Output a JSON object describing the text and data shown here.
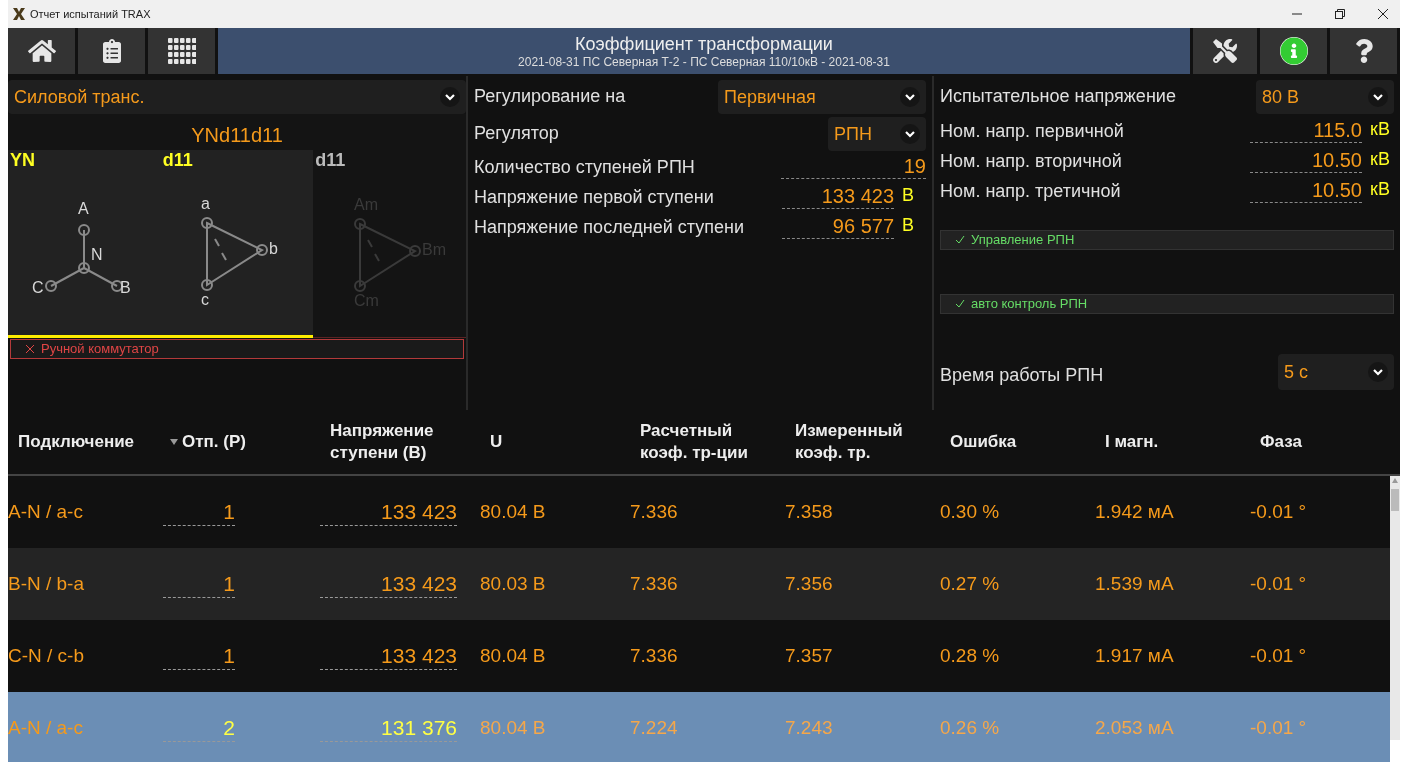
{
  "window": {
    "title": "Отчет испытаний TRAX"
  },
  "toolbar": {
    "title": "Коэффициент трансформации",
    "subtitle": "2021-08-31 ПС Северная Т-2 - ПС Северная 110/10кВ - 2021-08-31"
  },
  "left_panel": {
    "device": "Силовой транс.",
    "vector_group": "YNd11d11",
    "windings": [
      {
        "label": "YN",
        "kind": "star",
        "active": true,
        "terminals": [
          "A",
          "N",
          "C",
          "B"
        ]
      },
      {
        "label": "d11",
        "kind": "delta",
        "active": true,
        "terminals": [
          "a",
          "b",
          "c"
        ]
      },
      {
        "label": "d11",
        "kind": "delta",
        "active": false,
        "terminals": [
          "Am",
          "Bm",
          "Cm"
        ]
      }
    ],
    "manual_switch": {
      "label": "Ручной коммутатор",
      "checked": false
    }
  },
  "middle_panel": {
    "regulation": {
      "label": "Регулирование на",
      "value": "Первичная"
    },
    "regulator": {
      "label": "Регулятор",
      "value": "РПН"
    },
    "fields": [
      {
        "label": "Количество ступеней РПН",
        "value": "19"
      },
      {
        "label": "Напряжение первой ступени",
        "value": "133 423",
        "unit": "В"
      },
      {
        "label": "Напряжение последней ступени",
        "value": "96 577",
        "unit": "В"
      }
    ]
  },
  "right_panel": {
    "test_voltage": {
      "label": "Испытательное напряжение",
      "value": "80 В"
    },
    "fields": [
      {
        "label": "Ном. напр. первичной",
        "value": "115.0",
        "unit": "кВ"
      },
      {
        "label": "Ном. напр. вторичной",
        "value": "10.50",
        "unit": "кВ"
      },
      {
        "label": "Ном. напр. третичной",
        "value": "10.50",
        "unit": "кВ"
      }
    ],
    "checks": [
      {
        "label": "Управление РПН",
        "checked": true
      },
      {
        "label": "авто контроль РПН",
        "checked": true
      }
    ],
    "tap_time": {
      "label": "Время работы РПН",
      "value": "5 с"
    }
  },
  "table": {
    "columns": [
      {
        "label": "Подключение",
        "sorted": false
      },
      {
        "label": "Отп. (P)",
        "sorted": true
      },
      {
        "label": "Напряжение ступени (В)",
        "sorted": false
      },
      {
        "label": "U",
        "sorted": false
      },
      {
        "label": "Расчетный коэф. тр-ции",
        "sorted": false
      },
      {
        "label": "Измеренный коэф. тр.",
        "sorted": false
      },
      {
        "label": "Ошибка",
        "sorted": false
      },
      {
        "label": "I магн.",
        "sorted": false
      },
      {
        "label": "Фаза",
        "sorted": false
      }
    ],
    "rows": [
      {
        "selected": false,
        "cells": [
          "A-N / a-c",
          "1",
          "133 423",
          "80.04 В",
          "7.336",
          "7.358",
          "0.30 %",
          "1.942 мА",
          "-0.01 °"
        ]
      },
      {
        "selected": false,
        "cells": [
          "B-N / b-a",
          "1",
          "133 423",
          "80.03 В",
          "7.336",
          "7.356",
          "0.27 %",
          "1.539 мА",
          "-0.01 °"
        ]
      },
      {
        "selected": false,
        "cells": [
          "C-N / c-b",
          "1",
          "133 423",
          "80.04 В",
          "7.336",
          "7.357",
          "0.28 %",
          "1.917 мА",
          "-0.01 °"
        ]
      },
      {
        "selected": true,
        "cells": [
          "A-N / a-c",
          "2",
          "131 376",
          "80.04 В",
          "7.224",
          "7.243",
          "0.26 %",
          "2.053 мА",
          "-0.01 °"
        ]
      }
    ]
  }
}
